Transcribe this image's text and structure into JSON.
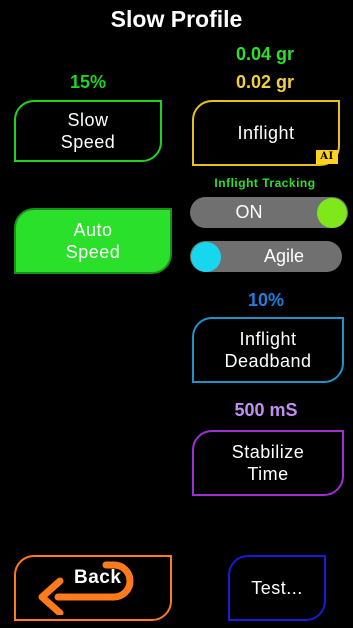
{
  "title": "Slow Profile",
  "slow_speed": {
    "value": "15%",
    "label": "Slow\nSpeed",
    "color": "#1ed51e"
  },
  "auto_speed": {
    "label": "Auto\nSpeed",
    "fill": "#2be02b"
  },
  "inflight": {
    "value_green": "0.04 gr",
    "value_yellow": "0.02 gr",
    "label": "Inflight",
    "badge": "AI",
    "color": "#e6c21a"
  },
  "inflight_tracking": {
    "heading": "Inflight Tracking",
    "toggle_on": {
      "label": "ON",
      "knob_color": "#7fe81a"
    },
    "toggle_agile": {
      "label": "Agile",
      "knob_color": "#17d7ef"
    }
  },
  "deadband": {
    "value": "10%",
    "label": "Inflight\nDeadband",
    "color": "#1f93c9"
  },
  "stabilize": {
    "value": "500 mS",
    "label": "Stabilize\nTime",
    "color": "#9d2fd4"
  },
  "back_button": {
    "label": "Back",
    "color": "#ff7a1a"
  },
  "test_button": {
    "label": "Test...",
    "color": "#1a1ad8"
  }
}
